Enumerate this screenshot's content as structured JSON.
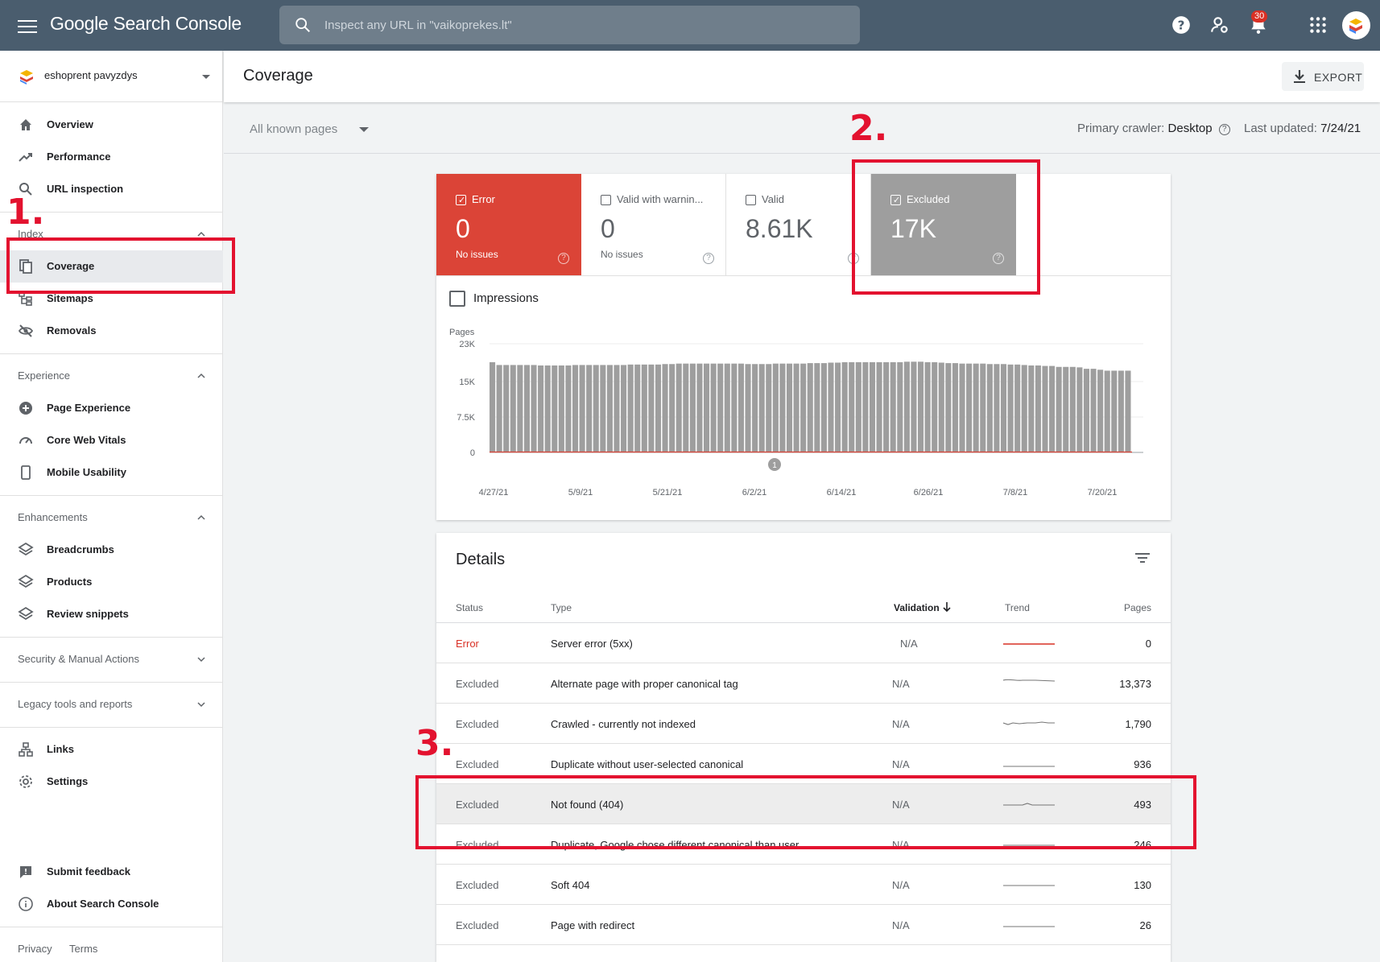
{
  "topbar": {
    "app_name": "Google Search Console",
    "search_placeholder": "Inspect any URL in \"vaikoprekes.lt\"",
    "notification_count": "30"
  },
  "sidebar": {
    "property_name": "eshoprent pavyzdys",
    "top_items": [
      {
        "label": "Overview",
        "icon": "home-icon"
      },
      {
        "label": "Performance",
        "icon": "trending-up-icon"
      },
      {
        "label": "URL inspection",
        "icon": "search-icon"
      }
    ],
    "index": {
      "title": "Index",
      "items": [
        {
          "label": "Coverage",
          "icon": "coverage-icon"
        },
        {
          "label": "Sitemaps",
          "icon": "sitemap-icon"
        },
        {
          "label": "Removals",
          "icon": "eye-off-icon"
        }
      ]
    },
    "experience": {
      "title": "Experience",
      "items": [
        {
          "label": "Page Experience",
          "icon": "plus-circle-icon"
        },
        {
          "label": "Core Web Vitals",
          "icon": "speedometer-icon"
        },
        {
          "label": "Mobile Usability",
          "icon": "phone-icon"
        }
      ]
    },
    "enhancements": {
      "title": "Enhancements",
      "items": [
        {
          "label": "Breadcrumbs",
          "icon": "layers-icon"
        },
        {
          "label": "Products",
          "icon": "layers-icon"
        },
        {
          "label": "Review snippets",
          "icon": "layers-icon"
        }
      ]
    },
    "security_title": "Security & Manual Actions",
    "legacy_title": "Legacy tools and reports",
    "bottom_items": [
      {
        "label": "Links",
        "icon": "links-icon"
      },
      {
        "label": "Settings",
        "icon": "gear-icon"
      }
    ],
    "footer_items": [
      {
        "label": "Submit feedback",
        "icon": "feedback-icon"
      },
      {
        "label": "About Search Console",
        "icon": "info-icon"
      }
    ],
    "privacy": "Privacy",
    "terms": "Terms"
  },
  "header": {
    "title": "Coverage",
    "export_label": "EXPORT"
  },
  "filters": {
    "page_selector": "All known pages",
    "crawler_label": "Primary crawler:",
    "crawler_value": "Desktop",
    "updated_label": "Last updated:",
    "updated_value": "7/24/21"
  },
  "summary_tiles": [
    {
      "label": "Error",
      "value": "0",
      "sub": "No issues",
      "checked": true,
      "color": "#db4437"
    },
    {
      "label": "Valid with warnin...",
      "value": "0",
      "sub": "No issues",
      "checked": false
    },
    {
      "label": "Valid",
      "value": "8.61K",
      "sub": "",
      "checked": false
    },
    {
      "label": "Excluded",
      "value": "17K",
      "sub": "",
      "checked": true,
      "color": "#9e9e9e"
    }
  ],
  "impressions_label": "Impressions",
  "chart_data": {
    "type": "bar",
    "ylabel": "Pages",
    "yticks": [
      "23K",
      "15K",
      "7.5K",
      "0"
    ],
    "ylim": [
      0,
      23000
    ],
    "xticks": [
      "4/27/21",
      "5/9/21",
      "5/21/21",
      "6/2/21",
      "6/14/21",
      "6/26/21",
      "7/8/21",
      "7/20/21"
    ],
    "annotation": "1",
    "series": [
      {
        "name": "Excluded",
        "color": "#9e9e9e",
        "values": [
          19100,
          18500,
          18500,
          18500,
          18500,
          18500,
          18500,
          18400,
          18400,
          18400,
          18400,
          18400,
          18500,
          18500,
          18500,
          18500,
          18500,
          18500,
          18500,
          18500,
          18600,
          18600,
          18600,
          18600,
          18600,
          18700,
          18700,
          18800,
          18800,
          18800,
          18800,
          18800,
          18800,
          18800,
          18800,
          18800,
          18800,
          18700,
          18700,
          18700,
          18700,
          18800,
          18800,
          18800,
          18800,
          18800,
          18900,
          18900,
          18900,
          19000,
          19000,
          19100,
          19100,
          19100,
          19100,
          19100,
          19100,
          19100,
          19100,
          19100,
          19200,
          19200,
          19200,
          19100,
          19100,
          19000,
          18900,
          18900,
          18800,
          18800,
          18800,
          18800,
          18700,
          18700,
          18700,
          18600,
          18600,
          18500,
          18400,
          18400,
          18300,
          18300,
          18100,
          18100,
          18100,
          18000,
          17700,
          17700,
          17500,
          17300,
          17300,
          17300,
          17300
        ]
      },
      {
        "name": "Error",
        "color": "#db4437",
        "values": [
          0
        ]
      }
    ]
  },
  "details": {
    "title": "Details",
    "columns": [
      "Status",
      "Type",
      "Validation",
      "Trend",
      "Pages"
    ],
    "rows": [
      {
        "status": "Error",
        "type": "Server error (5xx)",
        "validation": "N/A",
        "pages": "0"
      },
      {
        "status": "Excluded",
        "type": "Alternate page with proper canonical tag",
        "validation": "N/A",
        "pages": "13,373"
      },
      {
        "status": "Excluded",
        "type": "Crawled - currently not indexed",
        "validation": "N/A",
        "pages": "1,790"
      },
      {
        "status": "Excluded",
        "type": "Duplicate without user-selected canonical",
        "validation": "N/A",
        "pages": "936"
      },
      {
        "status": "Excluded",
        "type": "Not found (404)",
        "validation": "N/A",
        "pages": "493"
      },
      {
        "status": "Excluded",
        "type": "Duplicate, Google chose different canonical than user",
        "validation": "N/A",
        "pages": "246"
      },
      {
        "status": "Excluded",
        "type": "Soft 404",
        "validation": "N/A",
        "pages": "130"
      },
      {
        "status": "Excluded",
        "type": "Page with redirect",
        "validation": "N/A",
        "pages": "26"
      }
    ]
  },
  "annotations": [
    "1.",
    "2.",
    "3."
  ],
  "colors": {
    "topbar": "#4a5d6e",
    "error": "#db4437",
    "excluded": "#9e9e9e",
    "annotation": "#e3122f"
  }
}
